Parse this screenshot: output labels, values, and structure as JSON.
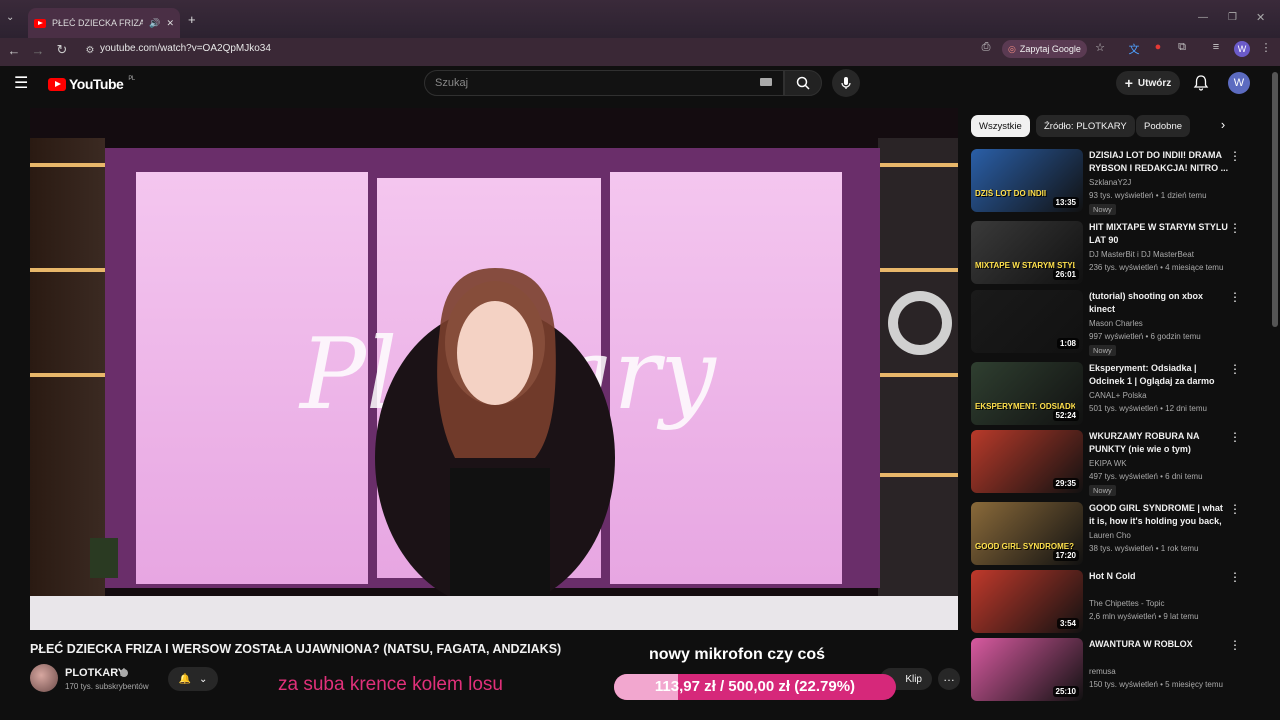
{
  "browser": {
    "tab_title": "PŁEĆ DZIECKA FRIZA I WERSOW...",
    "url": "youtube.com/watch?v=OA2QpMJko34",
    "zapytaj_label": "Zapytaj Google",
    "profile_letter": "W"
  },
  "youtube": {
    "logo_text": "YouTube",
    "logo_region": "PL",
    "search_placeholder": "Szukaj",
    "create_label": "Utwórz",
    "avatar_letter": "W"
  },
  "video": {
    "title": "PŁEĆ DZIECKA FRIZA I WERSOW ZOSTAŁA UJAWNIONA? (NATSU, FAGATA, ANDZIAKS)",
    "channel": "PLOTKARY",
    "subscribers": "170 tys. subskrybentów",
    "overlay_text_1": "za suba krence kolem losu",
    "overlay_text_2": "nowy mikrofon czy coś",
    "donation_goal": "113,97 zł / 500,00 zł (22.79%)",
    "donation_progress": 0.2279,
    "clip_label": "Klip",
    "scene_text": "Plotkary"
  },
  "chips": [
    "Wszystkie",
    "Źródło: PLOTKARY",
    "Podobne"
  ],
  "recommendations": [
    {
      "title": "DZISIAJ LOT DO INDII! DRAMA RYBSON I REDAKCJA! NITRO ...",
      "channel": "SzklanaY2J",
      "meta": "93 tys. wyświetleń • 1 dzień temu",
      "badge": "Nowy",
      "duration": "13:35",
      "color": "#2a5fa8",
      "thumb_text": "DZIŚ LOT DO INDII"
    },
    {
      "title": "HIT MIXTAPE W STARYM STYLU LAT 90",
      "channel": "DJ MasterBit i DJ MasterBeat",
      "meta": "236 tys. wyświetleń • 4 miesiące temu",
      "badge": "",
      "duration": "26:01",
      "color": "#3a3a3a",
      "thumb_text": "MIXTAPE W STARYM STYLU"
    },
    {
      "title": "(tutorial) shooting on xbox kinect",
      "channel": "Mason Charles",
      "meta": "997 wyświetleń • 6 godzin temu",
      "badge": "Nowy",
      "duration": "1:08",
      "color": "#1a1a1a",
      "thumb_text": ""
    },
    {
      "title": "Eksperyment: Odsiadka | Odcinek 1 | Oglądaj za darmo",
      "channel": "CANAL+ Polska",
      "meta": "501 tys. wyświetleń • 12 dni temu",
      "badge": "",
      "duration": "52:24",
      "color": "#2f3f30",
      "thumb_text": "EKSPERYMENT: ODSIADKA"
    },
    {
      "title": "WKURZAMY ROBURA NA PUNKTY (nie wie o tym)",
      "channel": "EKIPA WK",
      "meta": "497 tys. wyświetleń • 6 dni temu",
      "badge": "Nowy",
      "duration": "29:35",
      "color": "#b83a2a",
      "thumb_text": ""
    },
    {
      "title": "GOOD GIRL SYNDROME | what it is, how it's holding you back, ...",
      "channel": "Lauren Cho",
      "meta": "38 tys. wyświetleń • 1 rok temu",
      "badge": "",
      "duration": "17:20",
      "color": "#8a6a3a",
      "thumb_text": "GOOD GIRL SYNDROME?"
    },
    {
      "title": "Hot N Cold",
      "channel": "The Chipettes - Topic",
      "meta": "2,6 mln wyświetleń • 9 lat temu",
      "badge": "",
      "duration": "3:54",
      "color": "#c0392b",
      "thumb_text": ""
    },
    {
      "title": "AWANTURA W ROBLOX",
      "channel": "remusa",
      "meta": "150 tys. wyświetleń • 5 miesięcy temu",
      "badge": "",
      "duration": "25:10",
      "color": "#d85aa0",
      "thumb_text": ""
    }
  ]
}
